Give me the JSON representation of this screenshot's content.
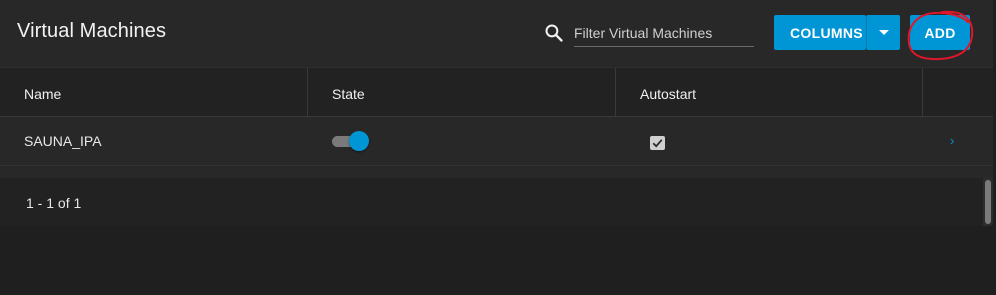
{
  "header": {
    "title": "Virtual Machines",
    "search_icon": "search-icon",
    "search_placeholder": "Filter Virtual Machines",
    "columns_label": "COLUMNS",
    "add_label": "ADD",
    "accent_color": "#0095d5",
    "annotation_color": "#e0162b"
  },
  "table": {
    "columns": [
      "Name",
      "State",
      "Autostart",
      ""
    ],
    "rows": [
      {
        "name": "SAUNA_IPA",
        "state_on": true,
        "autostart_checked": true,
        "expand_icon": "chevron-right-icon"
      }
    ]
  },
  "footer": {
    "range": "1 - 1 of 1"
  }
}
